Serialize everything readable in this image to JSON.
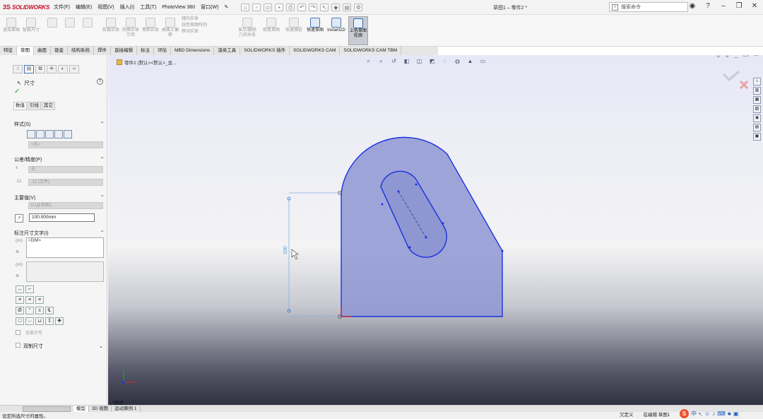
{
  "app": {
    "logo_ds": "3S",
    "logo_brand": "SOLIDWORKS",
    "doc_title": "草图1 – 零件2 *"
  },
  "menu": [
    "文件(F)",
    "编辑(E)",
    "视图(V)",
    "插入(I)",
    "工具(T)",
    "PhotoView 360",
    "窗口(W)"
  ],
  "search": {
    "placeholder": "搜索命令"
  },
  "ribbon": {
    "buttons": [
      {
        "label": "退出草图"
      },
      {
        "label": "智能尺寸"
      },
      {
        "label": "剪裁实体"
      },
      {
        "label": "转换实体引用"
      },
      {
        "label": "等距实体"
      },
      {
        "label": "曲面上偏移"
      },
      {
        "label": "镜向实体"
      },
      {
        "label": "线性草图阵列"
      },
      {
        "label": "移动实体"
      },
      {
        "label": "显示/删除几何关系"
      },
      {
        "label": "修复草图"
      },
      {
        "label": "快速捕捉"
      },
      {
        "label": "快速草图"
      },
      {
        "label": "Instant2D"
      },
      {
        "label": "上色草图轮廓"
      }
    ]
  },
  "tabs": [
    "特征",
    "草图",
    "曲面",
    "钣金",
    "结构系统",
    "焊件",
    "直接编辑",
    "标注",
    "评估",
    "MBD Dimensions",
    "渲染工具",
    "SOLIDWORKS 插件",
    "SOLIDWORKS CAM",
    "SOLIDWORKS CAM TBM"
  ],
  "active_tab": "草图",
  "property_manager": {
    "title": "尺寸",
    "subtabs": [
      "数值",
      "引线",
      "其它"
    ],
    "style_label": "样式(S)",
    "style_value": "<无>",
    "tolerance_label": "公差/精度(P)",
    "tolerance_type": "无",
    "precision": ".12 (文件)",
    "primary_label": "主要值(V)",
    "primary_name": "D1@草图1",
    "primary_value": "100.000mm",
    "dimtext_label": "标注尺寸文字(I)",
    "dimtext_value": "<DIM>",
    "all_caps": "全部大写",
    "dual_dim": "双制尺寸"
  },
  "graphics": {
    "breadcrumb": "零件2 (默认<<默认>_显...",
    "view_label": "*前视",
    "dimension_value": "100"
  },
  "model_tabs": [
    "模型",
    "3D 视图",
    "运动算例 1"
  ],
  "status": {
    "left": "设定所选尺寸的属性。",
    "state": "欠定义",
    "editing": "在编辑 草图1"
  },
  "colors": {
    "sketch_fill": "#8e97d2",
    "sketch_edge": "#1a32e0",
    "brand_red": "#c8102e"
  }
}
